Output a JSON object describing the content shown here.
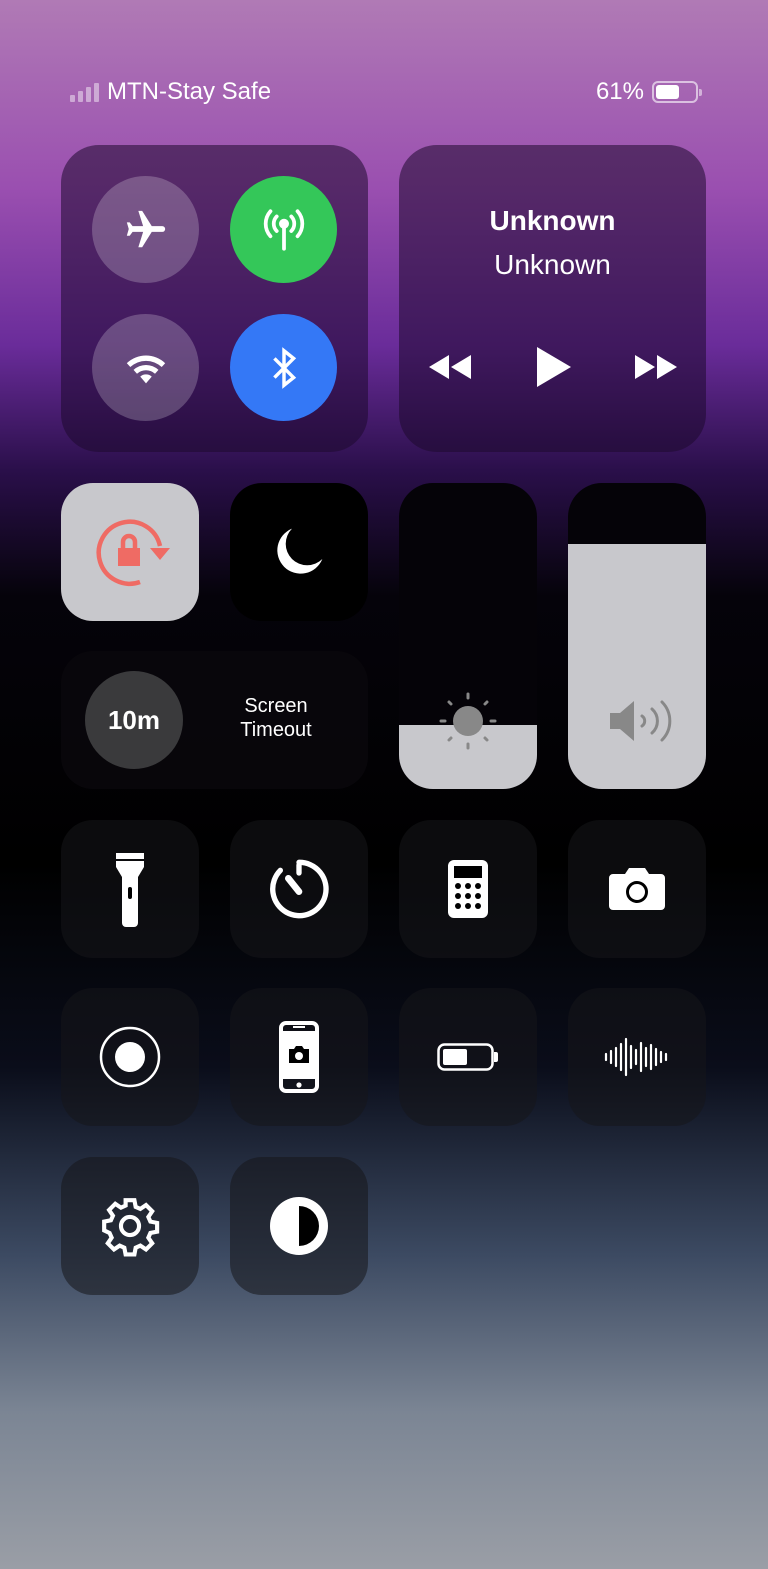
{
  "status": {
    "carrier": "MTN-Stay Safe",
    "battery_percent": "61%",
    "battery_level": 0.61,
    "signal_bars_active": 0
  },
  "connectivity": {
    "airplane": {
      "icon": "airplane-icon",
      "active": false
    },
    "cellular": {
      "icon": "antenna-icon",
      "active": true,
      "color": "#34c759"
    },
    "wifi": {
      "icon": "wifi-icon",
      "active": false
    },
    "bluetooth": {
      "icon": "bluetooth-icon",
      "active": true,
      "color": "#3478f6"
    }
  },
  "media": {
    "title": "Unknown",
    "artist": "Unknown"
  },
  "rotation_lock": {
    "active": true,
    "color": "#ef6b64"
  },
  "screen_timeout": {
    "value": "10m",
    "label_line1": "Screen",
    "label_line2": "Timeout"
  },
  "brightness": {
    "level": 0.21
  },
  "volume": {
    "level": 0.8
  },
  "tiles": [
    "flashlight-icon",
    "timer-icon",
    "calculator-icon",
    "camera-icon",
    "screen-record-icon",
    "screenshot-icon",
    "battery-saver-icon",
    "voice-memo-icon",
    "settings-icon",
    "dark-mode-icon"
  ]
}
